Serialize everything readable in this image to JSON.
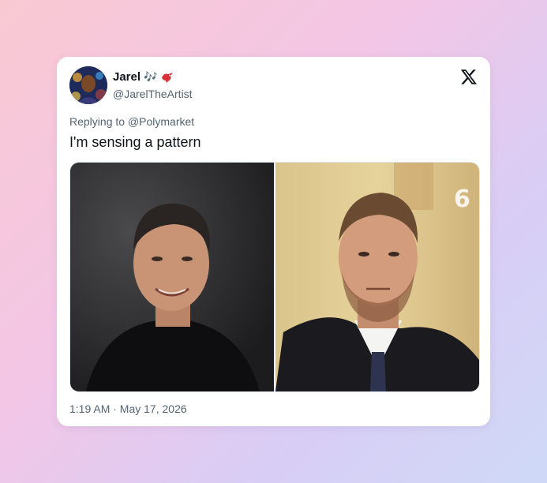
{
  "tweet": {
    "author": {
      "display_name": "Jarel",
      "badge_music": "🎶",
      "badge_icon": "red-bird-icon",
      "handle": "@JarelTheArtist"
    },
    "replying_to_prefix": "Replying to",
    "replying_to_mention": "@Polymarket",
    "text": "I'm sensing a pattern",
    "media": [
      {
        "kind": "photo",
        "subject": "smiling-man-dark-shirt"
      },
      {
        "kind": "photo",
        "subject": "man-in-judge-robe",
        "watermark": "6"
      }
    ],
    "timestamp": "1:19 AM · May 17, 2026"
  },
  "icons": {
    "platform": "x-logo-icon"
  },
  "colors": {
    "card_bg": "#ffffff",
    "primary_text": "#0f1419",
    "secondary_text": "#536471",
    "badge_blue": "#3b8fe0",
    "badge_red": "#d8313a"
  }
}
